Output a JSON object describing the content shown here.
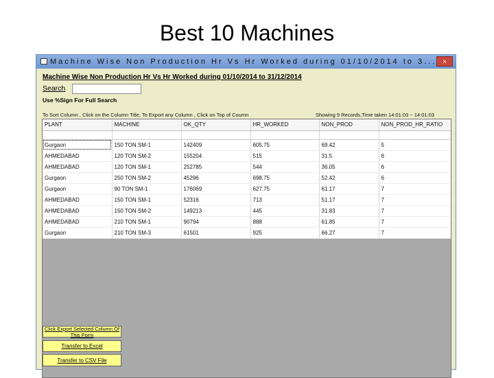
{
  "slide": {
    "title": "Best 10 Machines"
  },
  "window": {
    "title": "Machine Wise Non Production Hr Vs Hr Worked during 01/10/2014 to 3...",
    "close_label": "×"
  },
  "form": {
    "heading": "Machine Wise Non Production Hr Vs Hr Worked during 01/10/2014 to 31/12/2014",
    "search_label": "Search",
    "search_value": "",
    "hint": "Use %Sign For Full Search",
    "sort_hint": "To Sort Column , Click on the Column Title, To Export any Column , Click on Top of Coumn",
    "status": "Showing 9 Records,Time taken 14:01:03 ~ 14:01:03"
  },
  "table": {
    "columns": [
      "PLANT",
      "MACHINE",
      "OK_QTY",
      "HR_WORKED",
      "NON_PROD",
      "NON_PROD_HR_RATIO"
    ],
    "rows": [
      [
        "Gurgaon",
        "150 TON SM-1",
        "142409",
        "605.75",
        "69.42",
        "5"
      ],
      [
        "AHMEDABAD",
        "120 TON SM-2",
        "155204",
        "515",
        "31.5",
        "6"
      ],
      [
        "AHMEDABAD",
        "120 TON SM-1",
        "252785",
        "544",
        "36.05",
        "6"
      ],
      [
        "Gurgaon",
        "250 TON SM-2",
        "45296",
        "698.75",
        "52.42",
        "6"
      ],
      [
        "Gurgaon",
        "90 TON SM-1",
        "176069",
        "627.75",
        "61.17",
        "7"
      ],
      [
        "AHMEDABAD",
        "150 TON SM-1",
        "52316",
        "713",
        "51.17",
        "7"
      ],
      [
        "AHMEDABAD",
        "150 TON SM-2",
        "149213",
        "445",
        "31.83",
        "7"
      ],
      [
        "AHMEDABAD",
        "210 TON SM-1",
        "90794",
        "888",
        "61.85",
        "7"
      ],
      [
        "Gurgaon",
        "210 TON SM-3",
        "61501",
        "925",
        "66.27",
        "7"
      ]
    ]
  },
  "buttons": {
    "export_selected": "Click Export Selected Column Of This Form",
    "transfer_excel": "Transfer to Excel",
    "transfer_csv": "Transfer to CSV File"
  },
  "colors": {
    "window_bg": "#ececc8",
    "titlebar": "#7fa4da",
    "button_bg": "#ffff8c",
    "grid_empty": "#a9a9a9",
    "close": "#c9473c"
  }
}
